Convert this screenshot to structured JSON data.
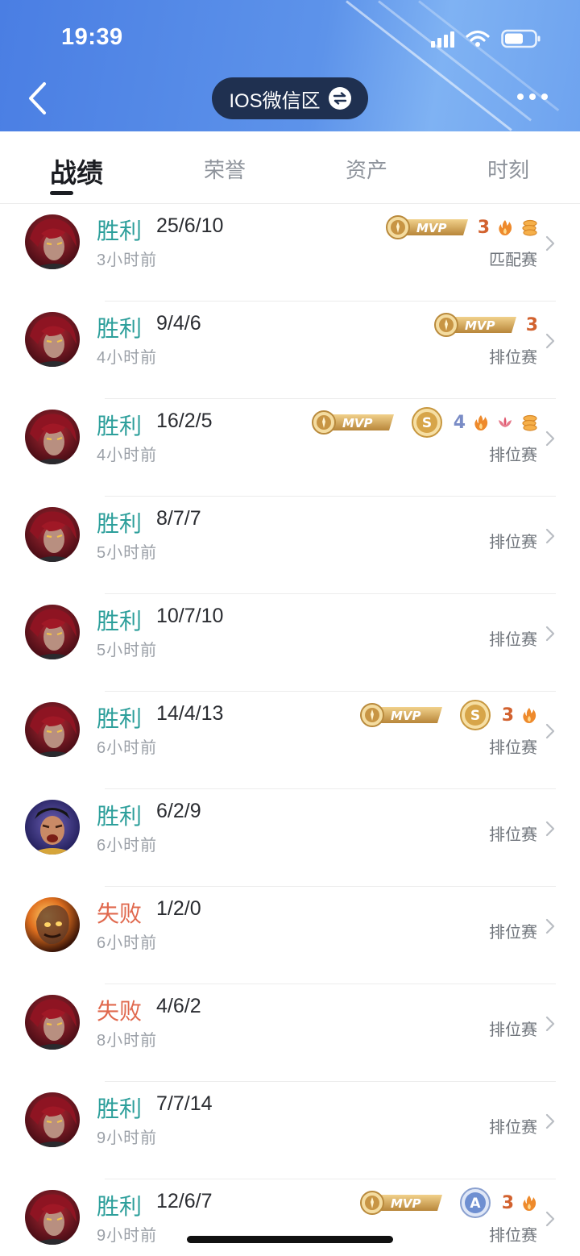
{
  "status_bar": {
    "time": "19:39"
  },
  "header": {
    "server_label": "IOS微信区",
    "colors": {
      "bg": "#5087e6",
      "pill": "#1f3050"
    }
  },
  "tabs": [
    {
      "label": "战绩",
      "active": true
    },
    {
      "label": "荣誉",
      "active": false
    },
    {
      "label": "资产",
      "active": false
    },
    {
      "label": "时刻",
      "active": false
    }
  ],
  "matches": [
    {
      "result": "胜利",
      "outcome": "win",
      "kda": "25/6/10",
      "time": "3小时前",
      "mode": "匹配赛",
      "hero": "red-hair",
      "mvp": true,
      "medal": null,
      "kill_streak": "3",
      "icons": [
        "flame",
        "coins"
      ]
    },
    {
      "result": "胜利",
      "outcome": "win",
      "kda": "9/4/6",
      "time": "4小时前",
      "mode": "排位赛",
      "hero": "red-hair",
      "mvp": true,
      "medal": null,
      "kill_streak": "3",
      "icons": []
    },
    {
      "result": "胜利",
      "outcome": "win",
      "kda": "16/2/5",
      "time": "4小时前",
      "mode": "排位赛",
      "hero": "red-hair",
      "mvp": true,
      "medal": "S",
      "kill_streak": "4",
      "icons": [
        "flame",
        "lotus",
        "coins"
      ]
    },
    {
      "result": "胜利",
      "outcome": "win",
      "kda": "8/7/7",
      "time": "5小时前",
      "mode": "排位赛",
      "hero": "red-hair",
      "mvp": false,
      "medal": null,
      "kill_streak": null,
      "icons": []
    },
    {
      "result": "胜利",
      "outcome": "win",
      "kda": "10/7/10",
      "time": "5小时前",
      "mode": "排位赛",
      "hero": "red-hair",
      "mvp": false,
      "medal": null,
      "kill_streak": null,
      "icons": []
    },
    {
      "result": "胜利",
      "outcome": "win",
      "kda": "14/4/13",
      "time": "6小时前",
      "mode": "排位赛",
      "hero": "red-hair",
      "mvp": true,
      "medal": "S",
      "kill_streak": "3",
      "icons": [
        "flame"
      ]
    },
    {
      "result": "胜利",
      "outcome": "win",
      "kda": "6/2/9",
      "time": "6小时前",
      "mode": "排位赛",
      "hero": "warrior",
      "mvp": false,
      "medal": null,
      "kill_streak": null,
      "icons": []
    },
    {
      "result": "失败",
      "outcome": "loss",
      "kda": "1/2/0",
      "time": "6小时前",
      "mode": "排位赛",
      "hero": "fire",
      "mvp": false,
      "medal": null,
      "kill_streak": null,
      "icons": []
    },
    {
      "result": "失败",
      "outcome": "loss",
      "kda": "4/6/2",
      "time": "8小时前",
      "mode": "排位赛",
      "hero": "red-hair",
      "mvp": false,
      "medal": null,
      "kill_streak": null,
      "icons": []
    },
    {
      "result": "胜利",
      "outcome": "win",
      "kda": "7/7/14",
      "time": "9小时前",
      "mode": "排位赛",
      "hero": "red-hair",
      "mvp": false,
      "medal": null,
      "kill_streak": null,
      "icons": []
    },
    {
      "result": "胜利",
      "outcome": "win",
      "kda": "12/6/7",
      "time": "9小时前",
      "mode": "排位赛",
      "hero": "red-hair",
      "mvp": true,
      "medal": "A",
      "kill_streak": "3",
      "icons": [
        "flame"
      ]
    }
  ],
  "colors": {
    "win": "#2d9f9b",
    "loss": "#e0694e",
    "mvp_gold": "#c9a04a"
  }
}
